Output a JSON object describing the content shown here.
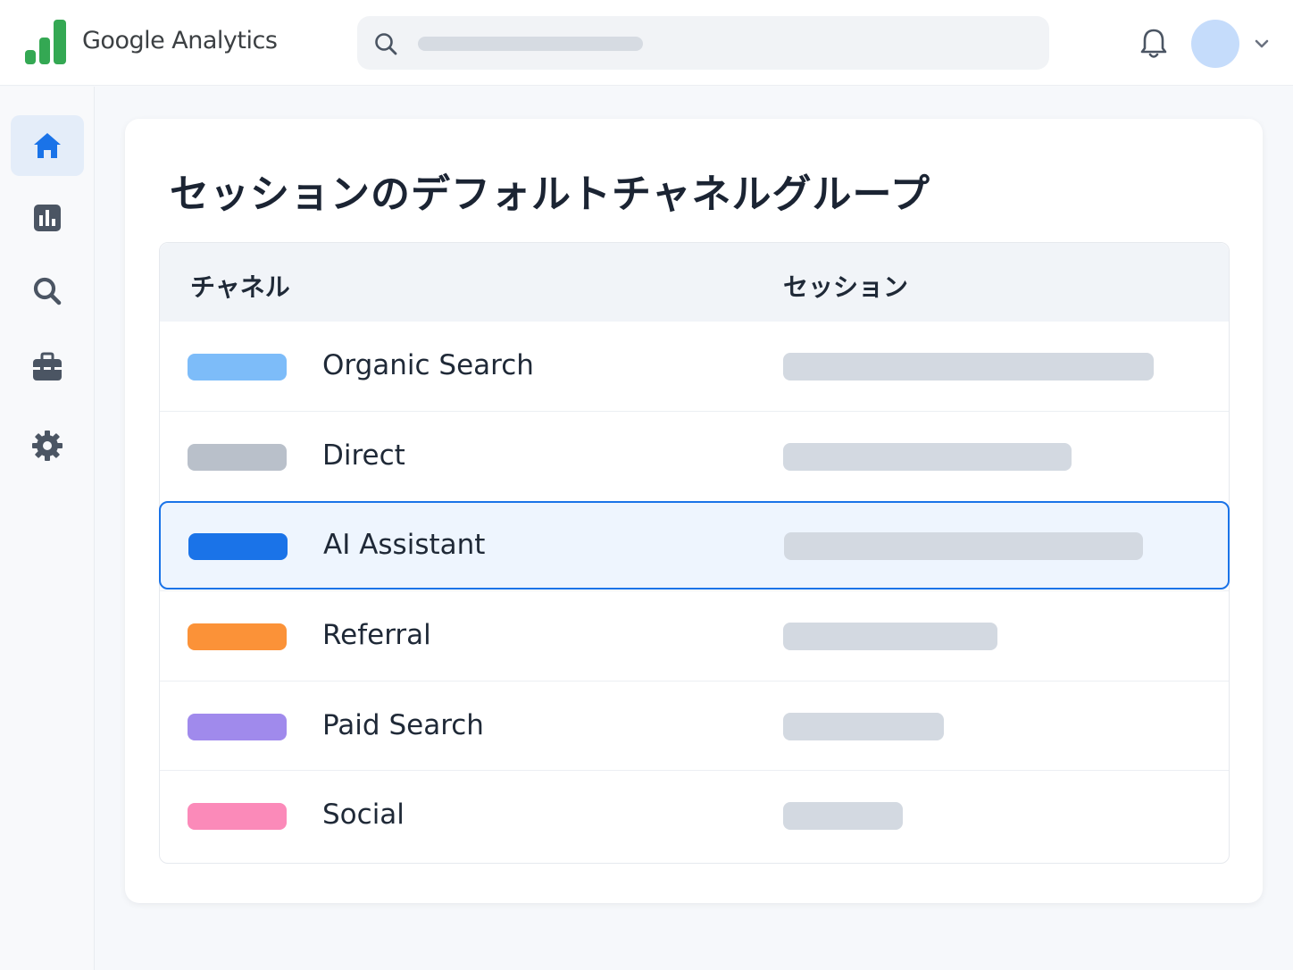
{
  "app": {
    "brand": "Google Analytics"
  },
  "header": {
    "search_placeholder": "",
    "icons": [
      "search-icon",
      "bell-icon",
      "avatar",
      "chevron-down-icon"
    ]
  },
  "sidebar": {
    "items": [
      {
        "name": "home",
        "icon": "home-icon",
        "active": true
      },
      {
        "name": "reports",
        "icon": "bar-chart-icon",
        "active": false
      },
      {
        "name": "explore",
        "icon": "search-icon",
        "active": false
      },
      {
        "name": "advertising",
        "icon": "briefcase-icon",
        "active": false
      },
      {
        "name": "settings",
        "icon": "gear-icon",
        "active": false
      }
    ]
  },
  "card": {
    "title": "セッションのデフォルトチャネルグループ",
    "columns": {
      "channel": "チャネル",
      "sessions": "セッション"
    },
    "rows": [
      {
        "channel": "Organic Search",
        "color": "#7dbcf9",
        "relative_sessions": 0.79,
        "selected": false
      },
      {
        "channel": "Direct",
        "color": "#b9c0ca",
        "relative_sessions": 0.615,
        "selected": false
      },
      {
        "channel": "AI Assistant",
        "color": "#1a73e8",
        "relative_sessions": 0.765,
        "selected": true
      },
      {
        "channel": "Referral",
        "color": "#fb9238",
        "relative_sessions": 0.457,
        "selected": false
      },
      {
        "channel": "Paid Search",
        "color": "#a08aec",
        "relative_sessions": 0.342,
        "selected": false
      },
      {
        "channel": "Social",
        "color": "#fb8ab9",
        "relative_sessions": 0.255,
        "selected": false
      }
    ]
  },
  "colors": {
    "accent": "#1a73e8",
    "bar_placeholder": "#d3d9e1",
    "logo_green": "#34a853"
  }
}
